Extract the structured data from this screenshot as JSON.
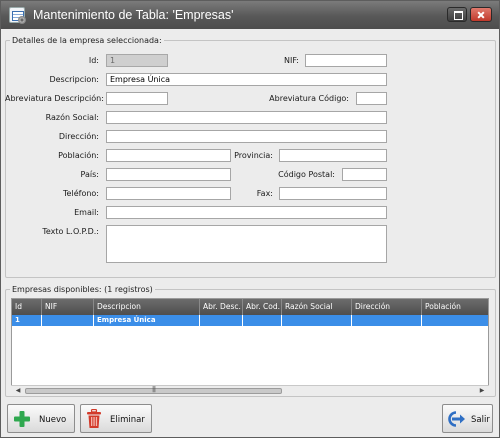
{
  "window": {
    "title": "Mantenimiento de Tabla: 'Empresas'"
  },
  "details": {
    "legend": "Detalles de la empresa seleccionada:",
    "fields": {
      "id": {
        "label": "Id:",
        "value": "1"
      },
      "nif": {
        "label": "NIF:",
        "value": ""
      },
      "descripcion": {
        "label": "Descripcion:",
        "value": "Empresa Única"
      },
      "abrev_descripcion": {
        "label": "Abreviatura Descripción:",
        "value": ""
      },
      "abrev_codigo": {
        "label": "Abreviatura Código:",
        "value": ""
      },
      "razon_social": {
        "label": "Razón Social:",
        "value": ""
      },
      "direccion": {
        "label": "Dirección:",
        "value": ""
      },
      "poblacion": {
        "label": "Población:",
        "value": ""
      },
      "provincia": {
        "label": "Provincia:",
        "value": ""
      },
      "pais": {
        "label": "País:",
        "value": ""
      },
      "codigo_postal": {
        "label": "Código Postal:",
        "value": ""
      },
      "telefono": {
        "label": "Teléfono:",
        "value": ""
      },
      "fax": {
        "label": "Fax:",
        "value": ""
      },
      "email": {
        "label": "Email:",
        "value": ""
      },
      "texto_lopd": {
        "label": "Texto L.O.P.D.:",
        "value": ""
      }
    }
  },
  "list": {
    "legend": "Empresas disponibles:  (1 registros)",
    "columns": [
      "Id",
      "NIF",
      "Descripcion",
      "Abr. Desc.",
      "Abr. Cod.",
      "Razón Social",
      "Dirección",
      "Población"
    ],
    "rows": [
      [
        "1",
        "",
        "Empresa Única",
        "",
        "",
        "",
        "",
        ""
      ]
    ],
    "scrollbar": {
      "grip": "|||"
    }
  },
  "buttons": {
    "nuevo": "Nuevo",
    "eliminar": "Eliminar",
    "salir": "Salir"
  },
  "colors": {
    "selected_row": "#3b8ee8",
    "titlebar": "#585858",
    "close_button": "#c0392b",
    "add_icon": "#2fa84f",
    "delete_icon": "#d23a2a",
    "exit_icon": "#2f6fc4"
  },
  "icons": [
    "app-table-icon",
    "maximize-icon",
    "close-icon",
    "add-icon",
    "trash-icon",
    "exit-icon",
    "scroll-left-icon",
    "scroll-right-icon"
  ]
}
